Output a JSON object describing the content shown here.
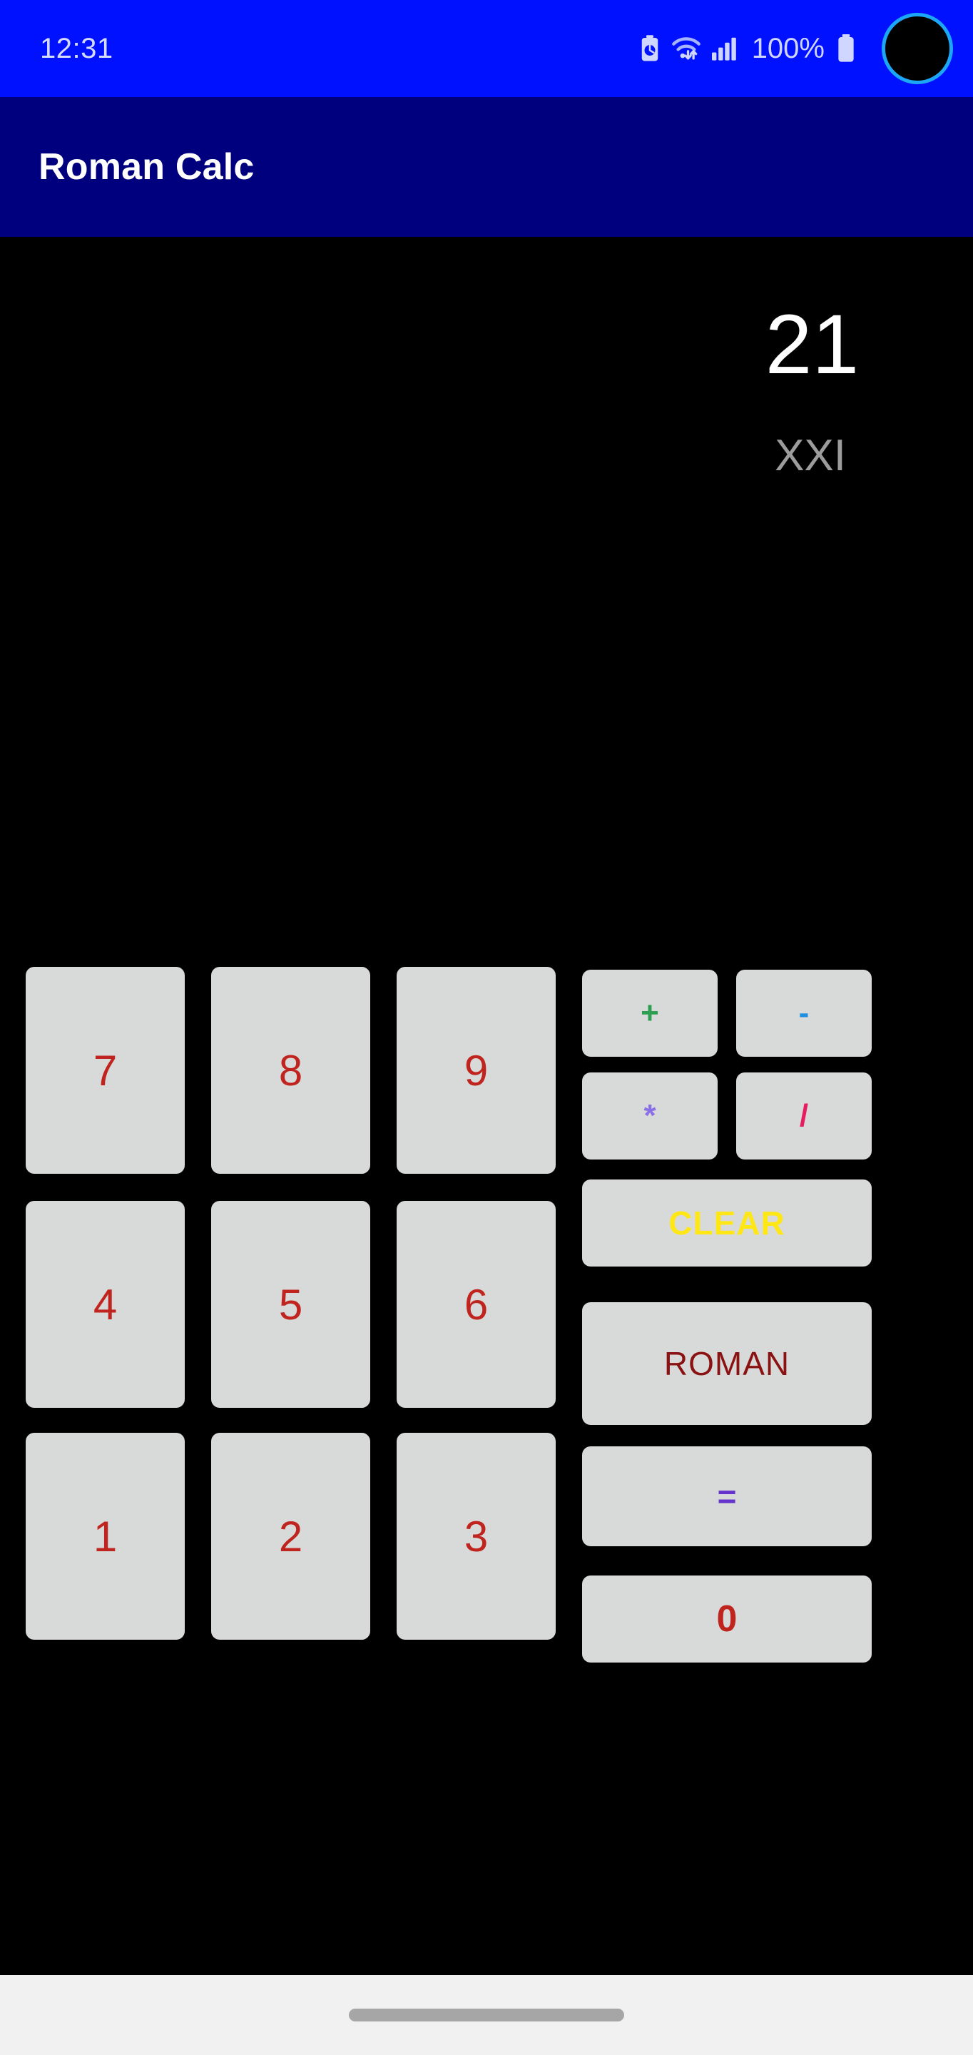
{
  "status_bar": {
    "clock": "12:31",
    "battery_percent": "100%",
    "icons": [
      "battery-saver-icon",
      "wifi-icon",
      "cellular-signal-icon",
      "battery-icon",
      "camera-cutout"
    ],
    "background_color": "#0011FF",
    "foreground_color": "#D6DCFF",
    "camera_ring_color": "#1BA7F5"
  },
  "app_bar": {
    "title": "Roman Calc",
    "background_color": "#00007E",
    "title_color": "#FFFFFF"
  },
  "display": {
    "decimal_value": "21",
    "roman_value": "XXI",
    "decimal_color": "#FFFFFF",
    "roman_color": "#9C9C9C",
    "background_color": "#000000"
  },
  "keypad": {
    "key_background_color": "#D8DAD9",
    "digit_color": "#C0241F",
    "rows": [
      [
        {
          "name": "key-7",
          "label": "7"
        },
        {
          "name": "key-8",
          "label": "8"
        },
        {
          "name": "key-9",
          "label": "9"
        }
      ],
      [
        {
          "name": "key-4",
          "label": "4"
        },
        {
          "name": "key-5",
          "label": "5"
        },
        {
          "name": "key-6",
          "label": "6"
        }
      ],
      [
        {
          "name": "key-1",
          "label": "1"
        },
        {
          "name": "key-2",
          "label": "2"
        },
        {
          "name": "key-3",
          "label": "3"
        }
      ]
    ],
    "operators": [
      {
        "name": "key-plus",
        "label": "+",
        "color": "#2E9E4F"
      },
      {
        "name": "key-minus",
        "label": "-",
        "color": "#1E8FE0"
      },
      {
        "name": "key-multiply",
        "label": "*",
        "color": "#8A6FE8"
      },
      {
        "name": "key-divide",
        "label": "/",
        "color": "#E81B60"
      }
    ],
    "actions": {
      "clear": {
        "label": "CLEAR",
        "color": "#FFE716"
      },
      "roman": {
        "label": "ROMAN",
        "color": "#8A1212"
      },
      "equals": {
        "label": "=",
        "color": "#6633CC"
      },
      "zero": {
        "label": "0",
        "color": "#C0241F"
      }
    }
  },
  "nav_bar": {
    "background_color": "#F1F1F1",
    "pill_color": "#A6A6A6"
  }
}
